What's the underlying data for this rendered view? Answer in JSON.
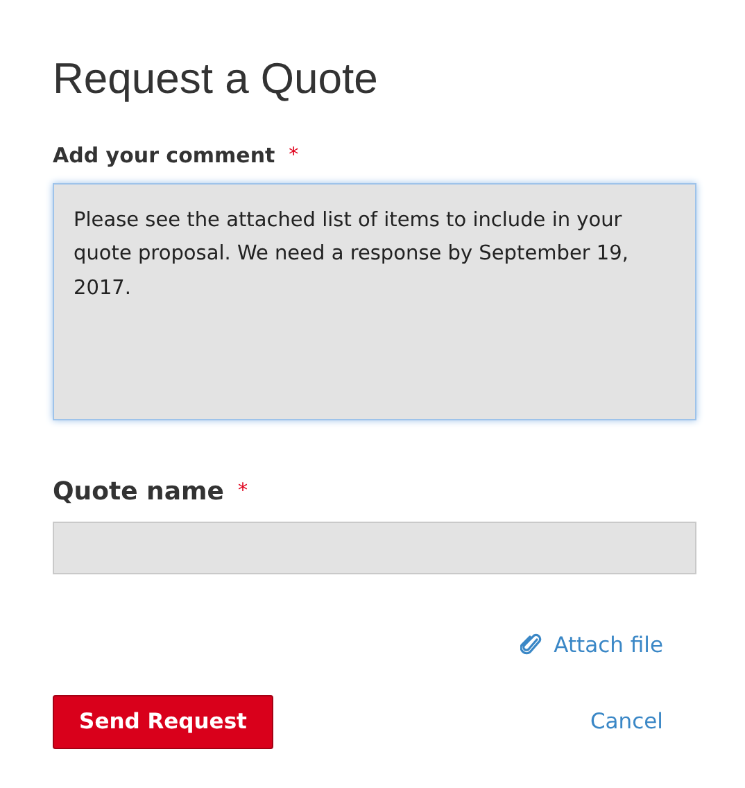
{
  "title": "Request a Quote",
  "fields": [
    {
      "kind": "textarea",
      "label": "Add your comment",
      "required_mark": "*",
      "value": "Please see the attached list of items to include in your quote proposal. We need a response by September 19, 2017.",
      "focused": true
    },
    {
      "kind": "input",
      "label": "Quote name",
      "required_mark": "*",
      "focused": false
    }
  ],
  "attach_link": "Attach file",
  "buttons": {
    "primary": "Send Request",
    "cancel": "Cancel"
  }
}
